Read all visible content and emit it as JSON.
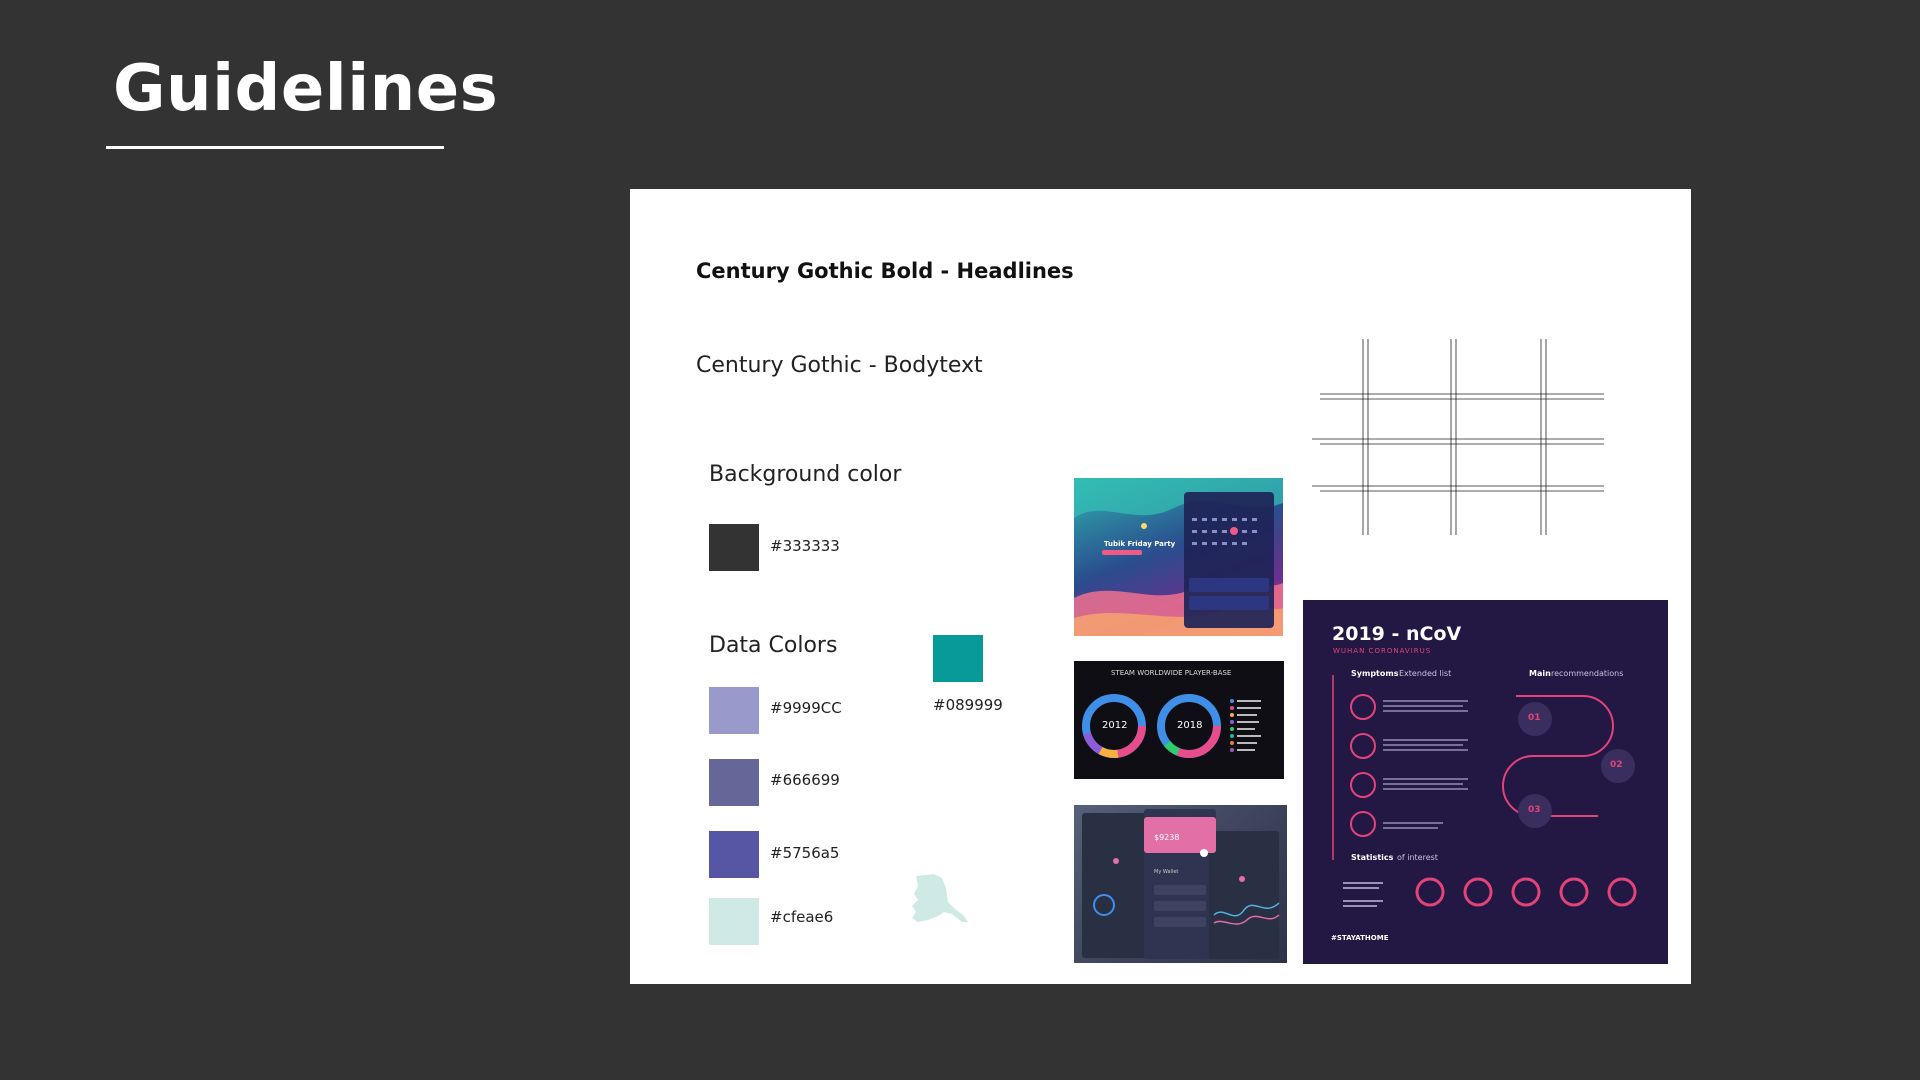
{
  "page": {
    "title": "Guidelines"
  },
  "typography": {
    "headline_sample": "Century Gothic Bold - Headlines",
    "body_sample": "Century Gothic - Bodytext"
  },
  "background_section": {
    "label": "Background color",
    "swatch": {
      "color": "#333333",
      "hex": "#333333"
    }
  },
  "data_colors_section": {
    "label": "Data Colors",
    "swatches": [
      {
        "color": "#9999CC",
        "hex": "#9999CC"
      },
      {
        "color": "#666699",
        "hex": "#666699"
      },
      {
        "color": "#5756a5",
        "hex": "#5756a5"
      },
      {
        "color": "#cfeae6",
        "hex": "#cfeae6"
      }
    ],
    "accent": {
      "color": "#089999",
      "hex": "#089999"
    }
  },
  "thumbnails": {
    "calendar": {
      "heading": "Tubik Friday Party"
    },
    "steam": {
      "title": "STEAM WORLDWIDE PLAYER-BASE",
      "year_left": "2012",
      "year_right": "2018"
    },
    "wallet": {
      "amount": "$9238",
      "label": "My Wallet"
    },
    "ncov": {
      "title": "2019 - nCoV",
      "subtitle": "WUHAN CORONAVIRUS",
      "symptoms": "Symptoms",
      "symptoms_suffix": "Extended list",
      "main": "Main",
      "main_suffix": "recommendations",
      "stats": "Statistics",
      "stats_suffix": "of interest",
      "steps": [
        "01",
        "02",
        "03"
      ],
      "hashtag": "#STAYATHOME"
    }
  }
}
